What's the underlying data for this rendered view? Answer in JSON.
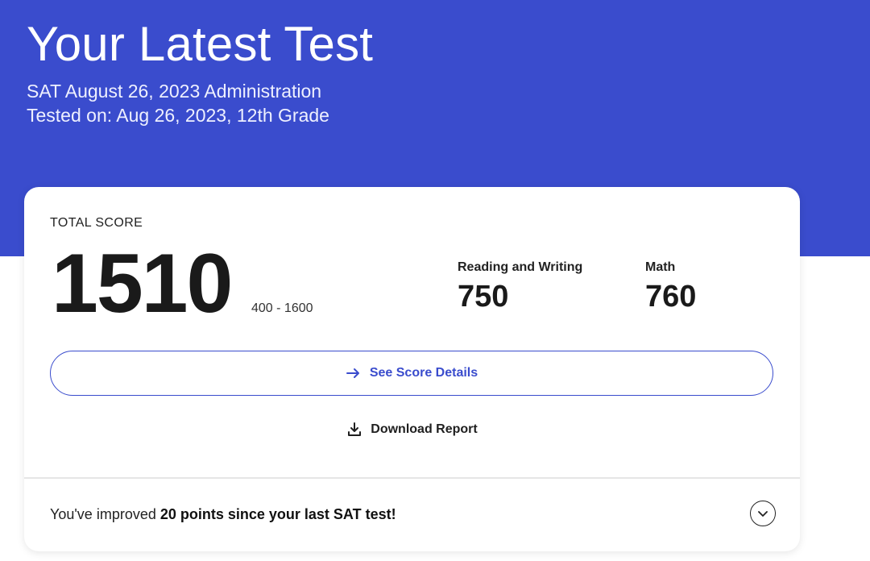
{
  "header": {
    "title": "Your Latest Test",
    "subtitle_line1": "SAT August 26, 2023 Administration",
    "subtitle_line2": "Tested on: Aug 26, 2023, 12th Grade"
  },
  "score_card": {
    "total_label": "TOTAL SCORE",
    "total_value": "1510",
    "total_range": "400 - 1600",
    "sections": [
      {
        "label": "Reading and Writing",
        "value": "750"
      },
      {
        "label": "Math",
        "value": "760"
      }
    ],
    "see_details_label": "See Score Details",
    "download_label": "Download Report"
  },
  "improvement": {
    "prefix": "You've improved ",
    "highlight": "20 points since your last SAT test!"
  },
  "icons": {
    "see_details": "arrow-right-icon",
    "download": "download-icon",
    "expand": "chevron-down-icon"
  },
  "colors": {
    "brand_blue": "#3a4ccd",
    "text_dark": "#1a1a1a"
  }
}
